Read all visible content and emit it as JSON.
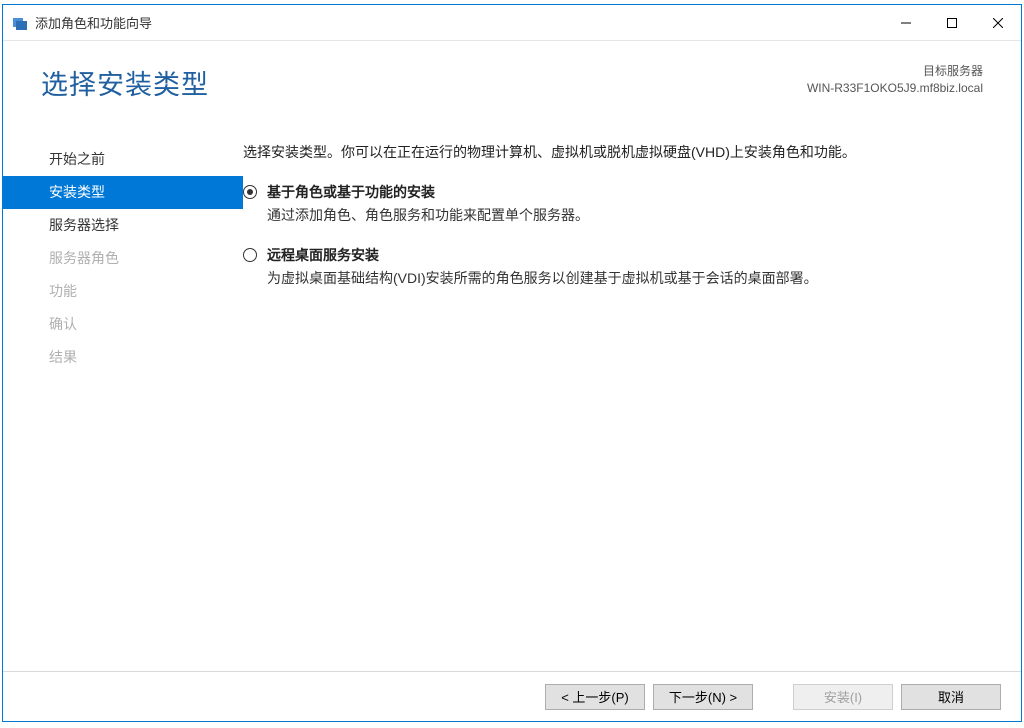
{
  "window": {
    "title": "添加角色和功能向导"
  },
  "header": {
    "page_title": "选择安装类型",
    "target_label": "目标服务器",
    "target_server": "WIN-R33F1OKO5J9.mf8biz.local"
  },
  "sidebar": {
    "items": [
      {
        "label": "开始之前",
        "state": "normal"
      },
      {
        "label": "安装类型",
        "state": "selected"
      },
      {
        "label": "服务器选择",
        "state": "normal"
      },
      {
        "label": "服务器角色",
        "state": "disabled"
      },
      {
        "label": "功能",
        "state": "disabled"
      },
      {
        "label": "确认",
        "state": "disabled"
      },
      {
        "label": "结果",
        "state": "disabled"
      }
    ]
  },
  "main": {
    "instruction": "选择安装类型。你可以在正在运行的物理计算机、虚拟机或脱机虚拟硬盘(VHD)上安装角色和功能。",
    "options": [
      {
        "title": "基于角色或基于功能的安装",
        "desc": "通过添加角色、角色服务和功能来配置单个服务器。",
        "selected": true
      },
      {
        "title": "远程桌面服务安装",
        "desc": "为虚拟桌面基础结构(VDI)安装所需的角色服务以创建基于虚拟机或基于会话的桌面部署。",
        "selected": false
      }
    ]
  },
  "footer": {
    "previous": "< 上一步(P)",
    "next": "下一步(N) >",
    "install": "安装(I)",
    "cancel": "取消"
  }
}
